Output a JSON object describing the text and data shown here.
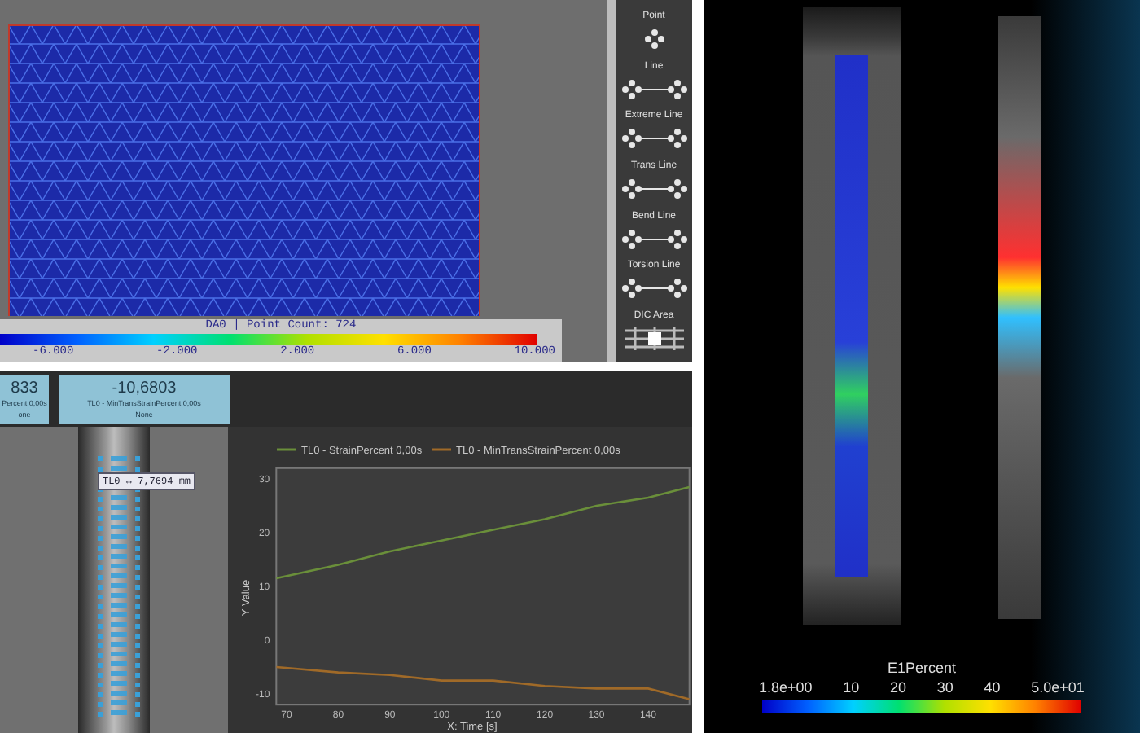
{
  "mesh_view": {
    "colorbar": {
      "title": "DA0 | Point Count: 724",
      "ticks": [
        "-6.000",
        "-2.000",
        "2.000",
        "6.000",
        "10.000"
      ]
    }
  },
  "tools": [
    {
      "label": "Point",
      "kind": "point"
    },
    {
      "label": "Line",
      "kind": "line"
    },
    {
      "label": "Extreme Line",
      "kind": "line"
    },
    {
      "label": "Trans Line",
      "kind": "line"
    },
    {
      "label": "Bend Line",
      "kind": "line"
    },
    {
      "label": "Torsion Line",
      "kind": "line"
    },
    {
      "label": "DIC Area",
      "kind": "area"
    }
  ],
  "value_cards": [
    {
      "value": "833",
      "label": "Percent 0,00s",
      "note": "one"
    },
    {
      "value": "-10,6803",
      "label": "TL0 - MinTransStrainPercent 0,00s",
      "note": "None"
    }
  ],
  "specimen_label": {
    "name": "TL0",
    "symbol": "↔",
    "reading": "7,7694 mm"
  },
  "chart": {
    "chart_data": {
      "type": "line",
      "legend": "top",
      "xlabel": "X: Time [s]",
      "ylabel": "Y Value",
      "x": [
        68,
        80,
        90,
        100,
        110,
        120,
        130,
        140,
        148
      ],
      "series": [
        {
          "name": "TL0 - StrainPercent 0,00s",
          "color": "#6a8f3a",
          "values": [
            11.5,
            14,
            16.5,
            18.5,
            20.5,
            22.5,
            25,
            26.5,
            28.5
          ]
        },
        {
          "name": "TL0 - MinTransStrainPercent 0,00s",
          "color": "#a06a28",
          "values": [
            -5,
            -6,
            -6.5,
            -7.5,
            -7.5,
            -8.5,
            -9,
            -9,
            -11
          ]
        }
      ],
      "xlim": [
        68,
        148
      ],
      "ylim": [
        -12,
        32
      ],
      "xticks": [
        70,
        80,
        90,
        100,
        110,
        120,
        130,
        140
      ],
      "yticks": [
        -10,
        0,
        10,
        20,
        30
      ]
    }
  },
  "strain_view": {
    "colorbar": {
      "title": "E1Percent",
      "ticks": [
        "1.8e+00",
        "10",
        "20",
        "30",
        "40",
        "5.0e+01"
      ]
    }
  }
}
